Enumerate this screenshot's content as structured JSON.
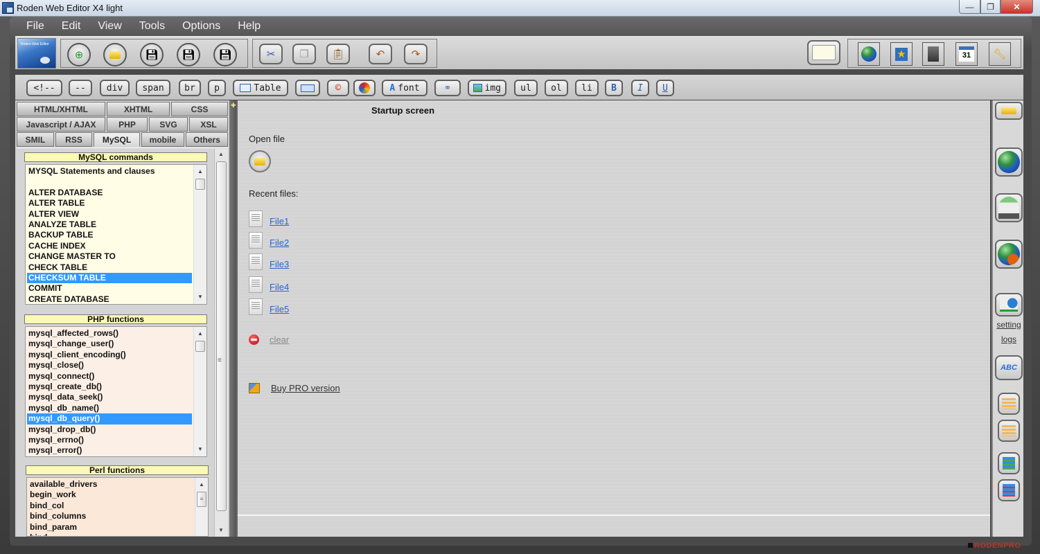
{
  "window": {
    "title": "Roden Web Editor X4 light",
    "controls": {
      "minimize": "—",
      "maximize": "❐",
      "close": "✕"
    }
  },
  "menu": [
    "File",
    "Edit",
    "View",
    "Tools",
    "Options",
    "Help"
  ],
  "toolbar1": {
    "file_buttons": [
      "new-file",
      "open-file",
      "save",
      "save-as",
      "save-all"
    ],
    "edit_buttons": [
      "cut",
      "copy",
      "paste",
      "undo",
      "redo"
    ],
    "preview_button": "preview",
    "tool_buttons": [
      "browse-web",
      "favorites",
      "calculator",
      "calendar",
      "tools"
    ],
    "calendar_day": "31"
  },
  "toolbar2": {
    "tags": [
      "<!--",
      "--",
      "div",
      "span",
      "br",
      "p",
      "Table",
      "",
      "",
      "",
      "font",
      "",
      "img",
      "ul",
      "ol",
      "li",
      "B",
      "I",
      "U"
    ]
  },
  "leftpanel": {
    "tabs_row1": [
      "HTML/XHTML",
      "XHTML",
      "CSS"
    ],
    "tabs_row2": [
      "Javascript / AJAX",
      "PHP",
      "SVG",
      "XSL"
    ],
    "tabs_row3": [
      "SMIL",
      "RSS",
      "MySQL",
      "mobile",
      "Others"
    ],
    "active_tab": "MySQL",
    "mysql_commands": {
      "header": "MySQL commands",
      "items": [
        "MYSQL Statements and clauses",
        "",
        "ALTER DATABASE",
        "ALTER TABLE",
        "ALTER VIEW",
        "ANALYZE TABLE",
        "BACKUP TABLE",
        "CACHE INDEX",
        "CHANGE MASTER TO",
        "CHECK TABLE",
        "CHECKSUM TABLE",
        "COMMIT",
        "CREATE DATABASE"
      ],
      "selected": "CHECKSUM TABLE"
    },
    "php_functions": {
      "header": "PHP functions",
      "items": [
        "mysql_affected_rows()",
        "mysql_change_user()",
        "mysql_client_encoding()",
        "mysql_close()",
        "mysql_connect()",
        "mysql_create_db()",
        "mysql_data_seek()",
        "mysql_db_name()",
        "mysql_db_query()",
        "mysql_drop_db()",
        "mysql_errno()",
        "mysql_error()"
      ],
      "selected": "mysql_db_query()"
    },
    "perl_functions": {
      "header": "Perl functions",
      "items": [
        "available_drivers",
        "begin_work",
        "bind_col",
        "bind_columns",
        "bind_param",
        "bind_..."
      ]
    }
  },
  "main": {
    "title": "Startup screen",
    "open_file_label": "Open file",
    "recent_files_label": "Recent files:",
    "recent_files": [
      "File1",
      "File2",
      "File3",
      "File4",
      "File5"
    ],
    "clear_label": "clear",
    "buy_pro_label": "Buy PRO version"
  },
  "rightpanel": {
    "setting_label": "setting",
    "logs_label": "logs"
  },
  "brand": "RODENPRO"
}
